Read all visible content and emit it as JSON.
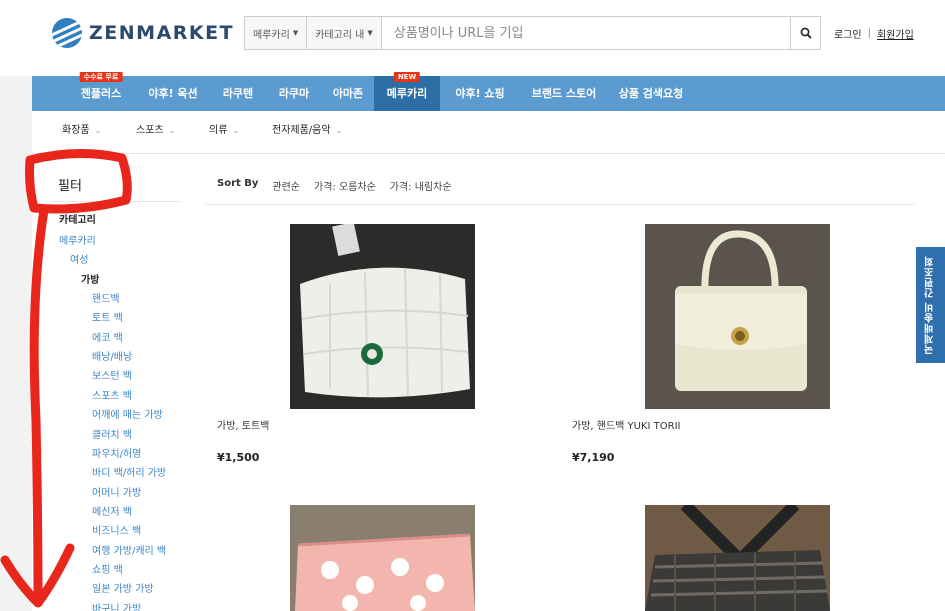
{
  "brand": {
    "logo_text": "ZENMARKET"
  },
  "search": {
    "site_select": "메루카리",
    "scope_select": "카테고리 내",
    "placeholder": "상품명이나 URL을 기입"
  },
  "auth": {
    "login": "로그인",
    "signup": "회원가입"
  },
  "nav": {
    "items": [
      {
        "label": "젠플러스",
        "badge": "수수료 무료"
      },
      {
        "label": "야후! 옥션"
      },
      {
        "label": "라쿠텐"
      },
      {
        "label": "라쿠마"
      },
      {
        "label": "아마존"
      },
      {
        "label": "메루카리",
        "badge": "NEW",
        "active": true
      },
      {
        "label": "야후! 쇼핑"
      },
      {
        "label": "브랜드 스토어"
      },
      {
        "label": "상품 검색요청"
      }
    ]
  },
  "categories": [
    "화장품",
    "스포츠",
    "의류",
    "전자제품/음악"
  ],
  "filter": {
    "title": "필터",
    "section": "카테고리",
    "root": "메루카리",
    "level1": "여성",
    "current": "가방",
    "subcategories": [
      "핸드백",
      "토트 백",
      "에코 백",
      "배낭/배낭",
      "보스턴 백",
      "스포츠 백",
      "어깨에 매는 가방",
      "클러치 백",
      "파우치/허영",
      "바디 백/허리 가방",
      "어머니 가방",
      "메신저 백",
      "비즈니스 백",
      "여행 가방/캐리 백",
      "쇼핑 백",
      "일본 가방 가방",
      "바구니 가방"
    ]
  },
  "sort": {
    "label": "Sort By",
    "options": [
      "관련순",
      "가격: 오름차순",
      "가격: 내림차순"
    ]
  },
  "products": [
    {
      "title": "가방, 토트백",
      "price": "¥1,500"
    },
    {
      "title": "가방, 핸드백 YUKI TORII",
      "price": "¥7,190"
    },
    {
      "title": "",
      "price": ""
    },
    {
      "title": "",
      "price": ""
    }
  ],
  "side_tab": {
    "label": "국제배송비 간편조회"
  },
  "colors": {
    "nav": "#5b9bd0",
    "nav_active": "#2e6ea6",
    "link": "#3b86c8",
    "badge": "#e5361a",
    "annotation": "#e8261c"
  }
}
